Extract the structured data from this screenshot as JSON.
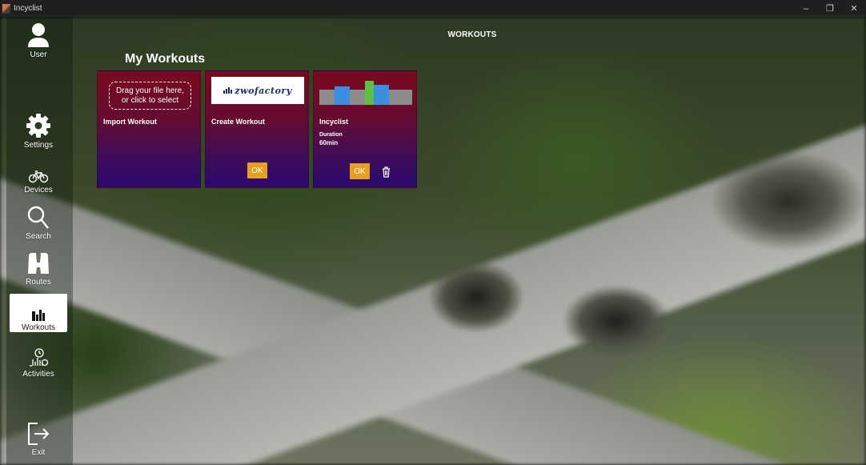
{
  "window": {
    "title": "Incyclist"
  },
  "header": {
    "title": "WORKOUTS"
  },
  "page": {
    "title": "My Workouts"
  },
  "sidebar": {
    "items": [
      {
        "label": "User",
        "icon": "user-icon"
      },
      {
        "label": "Settings",
        "icon": "gear-icon"
      },
      {
        "label": "Devices",
        "icon": "bicycle-icon"
      },
      {
        "label": "Search",
        "icon": "search-icon"
      },
      {
        "label": "Routes",
        "icon": "binoculars-icon"
      },
      {
        "label": "Workouts",
        "icon": "workout-chart-icon",
        "active": true
      },
      {
        "label": "Activities",
        "icon": "activities-icon"
      },
      {
        "label": "Exit",
        "icon": "exit-icon"
      }
    ]
  },
  "cards": {
    "import": {
      "title": "Import Workout",
      "drop_text": "Drag your file here, or click to select"
    },
    "create": {
      "title": "Create Workout",
      "logo_text": "zwofactory",
      "ok_label": "OK"
    },
    "incyclist": {
      "title": "Incyclist",
      "duration_label": "Duration",
      "duration_value": "60min",
      "ok_label": "OK"
    }
  },
  "colors": {
    "accent": "#e6a020",
    "card_top": "#7a0a1e",
    "card_bottom": "#2a0a6e"
  }
}
